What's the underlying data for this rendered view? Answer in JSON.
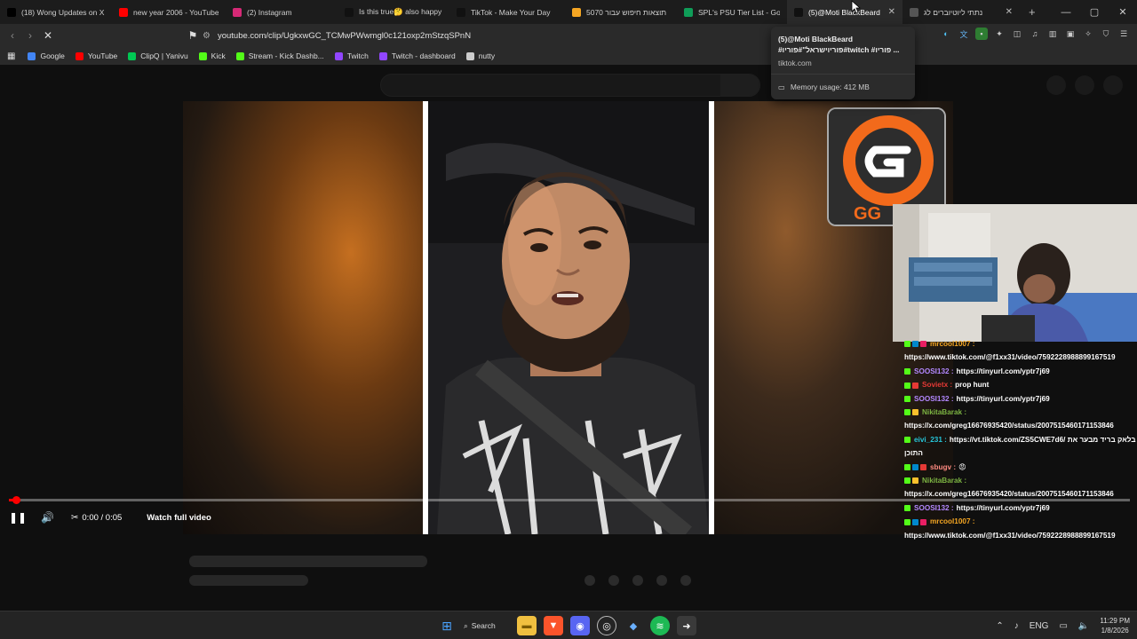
{
  "tabs": [
    {
      "title": "(18) Wong Updates on X",
      "icon": "x-icon",
      "color": "#000000",
      "active": false
    },
    {
      "title": "new year 2006 - YouTube",
      "icon": "youtube-icon",
      "color": "#ff0000",
      "active": false
    },
    {
      "title": "(2) Instagram",
      "icon": "instagram-icon",
      "color": "#d62976",
      "active": false
    },
    {
      "title": "Is this true🤔 also happy",
      "icon": "tiktok-icon",
      "color": "#111111",
      "active": false
    },
    {
      "title": "TikTok - Make Your Day",
      "icon": "tiktok-icon",
      "color": "#111111",
      "active": false
    },
    {
      "title": "תוצאות חיפוש עבור 5070",
      "icon": "ksp-icon",
      "color": "#f5a623",
      "active": false
    },
    {
      "title": "SPL's PSU Tier List - Goog",
      "icon": "sheets-icon",
      "color": "#0f9d58",
      "active": false
    },
    {
      "title": "(5)@Moti BlackBeard",
      "icon": "tiktok-icon",
      "color": "#111111",
      "active": true
    },
    {
      "title": "נתתי ליוטיוברים לג",
      "icon": "loading-icon",
      "color": "#555555",
      "active": false
    }
  ],
  "url": "youtube.com/clip/UgkxwGC_TCMwPWwmgl0c121oxp2mStzqSPnN",
  "bookmarks": [
    {
      "label": "Google",
      "color": "#4285f4"
    },
    {
      "label": "YouTube",
      "color": "#ff0000"
    },
    {
      "label": "ClipQ | Yanivu",
      "color": "#00c853"
    },
    {
      "label": "Kick",
      "color": "#53fc18"
    },
    {
      "label": "Stream - Kick Dashb...",
      "color": "#53fc18"
    },
    {
      "label": "Twitch",
      "color": "#9146ff"
    },
    {
      "label": "Twitch - dashboard",
      "color": "#9146ff"
    },
    {
      "label": "nutty",
      "color": "#cccccc"
    }
  ],
  "tooltip": {
    "title": "(5)@Moti BlackBeard #פוריוישראל\"#פוריו#twitch #פוריו ...",
    "domain": "tiktok.com",
    "memory": "Memory usage: 412 MB"
  },
  "player": {
    "time": "0:00 / 0:05",
    "watch_full": "Watch full video",
    "progress": 0.01
  },
  "logo_text": "GG",
  "chat": [
    {
      "user": "mrcool1007 :",
      "user_color": "#f5a623",
      "text": "",
      "badges": [
        "#53fc18",
        "#0088cc",
        "#e91e63"
      ]
    },
    {
      "user": "",
      "user_color": "#ffffff",
      "text": "https://www.tiktok.com/@f1xx31/video/7592228988899167519",
      "badges": []
    },
    {
      "user": "SOOSI132 :",
      "user_color": "#b388ff",
      "text": "https://tinyurl.com/yptr7j69",
      "badges": [
        "#53fc18"
      ]
    },
    {
      "user": "Sovietx :",
      "user_color": "#e53935",
      "text": "prop hunt",
      "badges": [
        "#53fc18",
        "#e53935"
      ]
    },
    {
      "user": "SOOSI132 :",
      "user_color": "#b388ff",
      "text": "https://tinyurl.com/yptr7j69",
      "badges": [
        "#53fc18"
      ]
    },
    {
      "user": "NikitaBarak :",
      "user_color": "#7cb342",
      "text": "",
      "badges": [
        "#53fc18",
        "#fbc02d"
      ]
    },
    {
      "user": "",
      "user_color": "#ffffff",
      "text": "https://x.com/greg16676935420/status/2007515460171153846",
      "badges": []
    },
    {
      "user": "eivi_231 :",
      "user_color": "#26c6da",
      "text": "https://vt.tiktok.com/ZS5CWE7d6/ בלאק בריד מבער את",
      "badges": [
        "#53fc18"
      ]
    },
    {
      "user": "",
      "user_color": "#ffffff",
      "text": "התוכן",
      "badges": []
    },
    {
      "user": "sbugv :",
      "user_color": "#ff8a80",
      "text": "😡",
      "badges": [
        "#53fc18",
        "#0088cc",
        "#e53935"
      ]
    },
    {
      "user": "NikitaBarak :",
      "user_color": "#7cb342",
      "text": "",
      "badges": [
        "#53fc18",
        "#fbc02d"
      ]
    },
    {
      "user": "",
      "user_color": "#ffffff",
      "text": "https://x.com/greg16676935420/status/2007515460171153846",
      "badges": []
    },
    {
      "user": "SOOSI132 :",
      "user_color": "#b388ff",
      "text": "https://tinyurl.com/yptr7j69",
      "badges": [
        "#53fc18"
      ]
    },
    {
      "user": "mrcool1007 :",
      "user_color": "#f5a623",
      "text": "",
      "badges": [
        "#53fc18",
        "#0088cc",
        "#e91e63"
      ]
    },
    {
      "user": "",
      "user_color": "#ffffff",
      "text": "https://www.tiktok.com/@f1xx31/video/7592228988899167519",
      "badges": []
    }
  ],
  "taskbar": {
    "search": "Search",
    "lang": "ENG",
    "time": "11:29 PM",
    "date": "1/8/2026"
  }
}
